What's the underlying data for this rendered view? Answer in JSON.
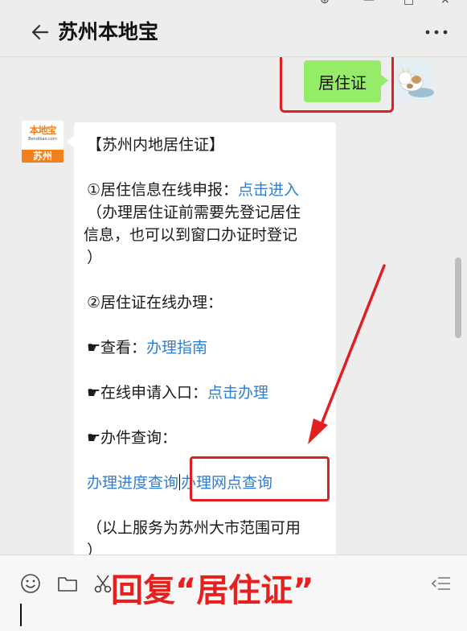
{
  "header": {
    "title": "苏州本地宝"
  },
  "outgoing_message": {
    "text": "居住证"
  },
  "bot": {
    "brand": "本地宝",
    "domain": "Bendibao.com",
    "city": "苏州"
  },
  "incoming_message": {
    "title": "【苏州内地居住证】",
    "item1_label": "①居住信息在线申报：",
    "item1_link": "点击进入",
    "item1_note_line1": "（办理居住证前需要先登记居住",
    "item1_note_line2": "信息，也可以到窗口办证时登记",
    "item1_note_line3": "）",
    "item2_label": "②居住证在线办理：",
    "view_label": "☛查看：",
    "view_link": "办理指南",
    "apply_label": "☛在线申请入口：",
    "apply_link": "点击办理",
    "query_label": "☛办件查询：",
    "progress_link": "办理进度查询",
    "outlets_link": "办理网点查询",
    "scope_line1": "（以上服务为苏州大市范围可用",
    "scope_line2": "）"
  },
  "overlay": {
    "text": "回复“居住证”"
  },
  "colors": {
    "accent_red": "#e8201d",
    "link_blue": "#2f7fd0",
    "bubble_green": "#95ec69",
    "brand_orange": "#f2811d"
  },
  "icons": [
    "back-arrow-icon",
    "more-icon",
    "emoji-icon",
    "folder-icon",
    "scissors-icon",
    "history-list-icon"
  ]
}
